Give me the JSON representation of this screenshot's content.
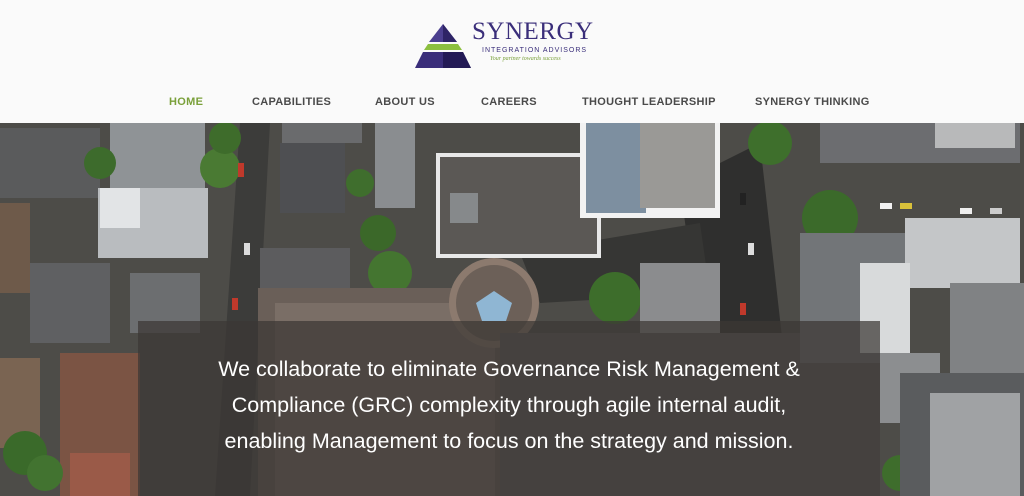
{
  "brand": {
    "name": "SYNERGY",
    "subtitle": "INTEGRATION ADVISORS",
    "tagline": "Your partner towards success",
    "colors": {
      "primary": "#3a2e7a",
      "accent": "#7aa03a"
    }
  },
  "nav": {
    "items": [
      {
        "label": "HOME",
        "active": true
      },
      {
        "label": "CAPABILITIES",
        "active": false
      },
      {
        "label": "ABOUT US",
        "active": false
      },
      {
        "label": "CAREERS",
        "active": false
      },
      {
        "label": "THOUGHT LEADERSHIP",
        "active": false
      },
      {
        "label": "SYNERGY THINKING",
        "active": false
      }
    ]
  },
  "hero": {
    "lines": [
      "We collaborate to eliminate Governance Risk Management &",
      "Compliance (GRC) complexity through agile internal audit,",
      "enabling Management to focus on the strategy and mission."
    ]
  }
}
